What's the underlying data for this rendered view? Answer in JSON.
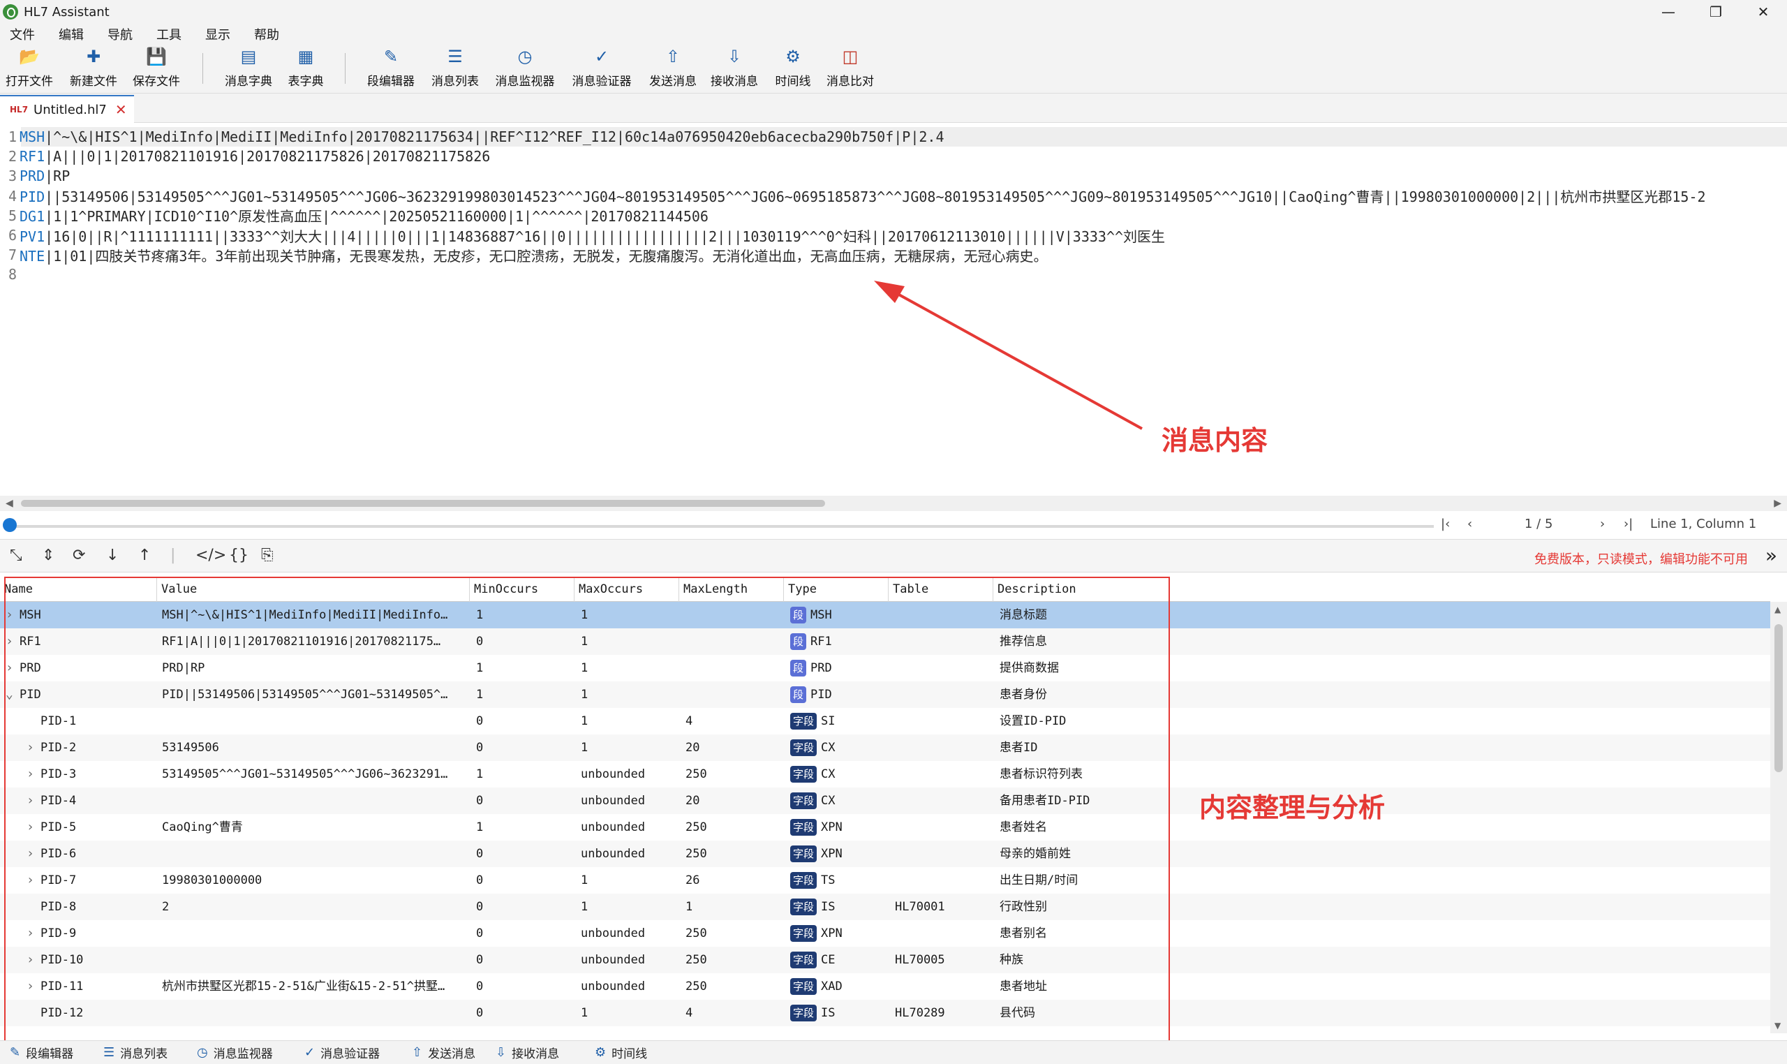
{
  "window": {
    "title": "HL7 Assistant"
  },
  "menu": [
    "文件",
    "编辑",
    "导航",
    "工具",
    "显示",
    "帮助"
  ],
  "toolbar": [
    {
      "label": "打开文件",
      "icon": "folder-open-icon"
    },
    {
      "label": "新建文件",
      "icon": "new-file-icon"
    },
    {
      "label": "保存文件",
      "icon": "save-icon"
    },
    {
      "label": "消息字典",
      "icon": "message-dictionary-icon"
    },
    {
      "label": "表字典",
      "icon": "table-dictionary-icon"
    },
    {
      "label": "段编辑器",
      "icon": "segment-editor-icon"
    },
    {
      "label": "消息列表",
      "icon": "message-list-icon"
    },
    {
      "label": "消息监视器",
      "icon": "message-monitor-icon"
    },
    {
      "label": "消息验证器",
      "icon": "message-validator-icon"
    },
    {
      "label": "发送消息",
      "icon": "send-icon"
    },
    {
      "label": "接收消息",
      "icon": "receive-icon"
    },
    {
      "label": "时间线",
      "icon": "timeline-icon"
    },
    {
      "label": "消息比对",
      "icon": "compare-icon"
    }
  ],
  "tab": {
    "badge": "HL7",
    "name": "Untitled.hl7"
  },
  "editor_lines": [
    {
      "seg": "MSH",
      "rest": "|^~\\&|HIS^1|MediInfo|MediII|MediInfo|20170821175634||REF^I12^REF_I12|60c14a076950420eb6acecba290b750f|P|2.4"
    },
    {
      "seg": "RF1",
      "rest": "|A|||0|1|20170821101916|20170821175826|20170821175826"
    },
    {
      "seg": "PRD",
      "rest": "|RP"
    },
    {
      "seg": "PID",
      "rest": "||53149506|53149505^^^JG01~53149505^^^JG06~362329199803014523^^^JG04~801953149505^^^JG06~0695185873^^^JG08~801953149505^^^JG09~801953149505^^^JG10||CaoQing^曹青||19980301000000|2|||杭州市拱墅区光郡15-2"
    },
    {
      "seg": "DG1",
      "rest": "|1|1^PRIMARY|ICD10^I10^原发性高血压|^^^^^^|20250521160000|1|^^^^^^|20170821144506"
    },
    {
      "seg": "PV1",
      "rest": "|16|0||R|^1111111111||3333^^刘大大|||4|||||0|||1|14836887^16||0|||||||||||||||||2|||1030119^^^0^妇科||20170612113010||||||V|3333^^刘医生"
    },
    {
      "seg": "NTE",
      "rest": "|1|01|四肢关节疼痛3年。3年前出现关节肿痛，无畏寒发热，无皮疹，无口腔溃疡，无脱发，无腹痛腹泻。无消化道出血，无高血压病，无糖尿病，无冠心病史。"
    },
    {
      "seg": "",
      "rest": ""
    }
  ],
  "annotations": {
    "message_content": "消息内容",
    "analysis": "内容整理与分析"
  },
  "status": {
    "page": "1 / 5",
    "cursor": "Line 1, Column 1"
  },
  "notice": "免费版本，只读模式，编辑功能不可用",
  "grid": {
    "columns": [
      "Name",
      "Value",
      "MinOccurs",
      "MaxOccurs",
      "MaxLength",
      "Type",
      "Table",
      "Description"
    ],
    "rows": [
      {
        "name": "MSH",
        "value": "MSH|^~\\&|HIS^1|MediInfo|MediII|MediInfo…",
        "min": "1",
        "max": "1",
        "len": "",
        "badge": "段",
        "type": "MSH",
        "table": "",
        "desc": "消息标题",
        "level": 0,
        "chev": ">"
      },
      {
        "name": "RF1",
        "value": "RF1|A|||0|1|20170821101916|20170821175…",
        "min": "0",
        "max": "1",
        "len": "",
        "badge": "段",
        "type": "RF1",
        "table": "",
        "desc": "推荐信息",
        "level": 0,
        "chev": ">"
      },
      {
        "name": "PRD",
        "value": "PRD|RP",
        "min": "1",
        "max": "1",
        "len": "",
        "badge": "段",
        "type": "PRD",
        "table": "",
        "desc": "提供商数据",
        "level": 0,
        "chev": ">"
      },
      {
        "name": "PID",
        "value": "PID||53149506|53149505^^^JG01~53149505^…",
        "min": "1",
        "max": "1",
        "len": "",
        "badge": "段",
        "type": "PID",
        "table": "",
        "desc": "患者身份",
        "level": 0,
        "chev": "v"
      },
      {
        "name": "PID-1",
        "value": "",
        "min": "0",
        "max": "1",
        "len": "4",
        "badge": "字段",
        "type": "SI",
        "table": "",
        "desc": "设置ID-PID",
        "level": 1,
        "chev": ""
      },
      {
        "name": "PID-2",
        "value": "53149506",
        "min": "0",
        "max": "1",
        "len": "20",
        "badge": "字段",
        "type": "CX",
        "table": "",
        "desc": "患者ID",
        "level": 1,
        "chev": ">"
      },
      {
        "name": "PID-3",
        "value": "53149505^^^JG01~53149505^^^JG06~3623291…",
        "min": "1",
        "max": "unbounded",
        "len": "250",
        "badge": "字段",
        "type": "CX",
        "table": "",
        "desc": "患者标识符列表",
        "level": 1,
        "chev": ">"
      },
      {
        "name": "PID-4",
        "value": "",
        "min": "0",
        "max": "unbounded",
        "len": "20",
        "badge": "字段",
        "type": "CX",
        "table": "",
        "desc": "备用患者ID-PID",
        "level": 1,
        "chev": ">"
      },
      {
        "name": "PID-5",
        "value": "CaoQing^曹青",
        "min": "1",
        "max": "unbounded",
        "len": "250",
        "badge": "字段",
        "type": "XPN",
        "table": "",
        "desc": "患者姓名",
        "level": 1,
        "chev": ">"
      },
      {
        "name": "PID-6",
        "value": "",
        "min": "0",
        "max": "unbounded",
        "len": "250",
        "badge": "字段",
        "type": "XPN",
        "table": "",
        "desc": "母亲的婚前姓",
        "level": 1,
        "chev": ">"
      },
      {
        "name": "PID-7",
        "value": "19980301000000",
        "min": "0",
        "max": "1",
        "len": "26",
        "badge": "字段",
        "type": "TS",
        "table": "",
        "desc": "出生日期/时间",
        "level": 1,
        "chev": ">"
      },
      {
        "name": "PID-8",
        "value": "2",
        "min": "0",
        "max": "1",
        "len": "1",
        "badge": "字段",
        "type": "IS",
        "table": "HL70001",
        "desc": "行政性别",
        "level": 1,
        "chev": ""
      },
      {
        "name": "PID-9",
        "value": "",
        "min": "0",
        "max": "unbounded",
        "len": "250",
        "badge": "字段",
        "type": "XPN",
        "table": "",
        "desc": "患者别名",
        "level": 1,
        "chev": ">"
      },
      {
        "name": "PID-10",
        "value": "",
        "min": "0",
        "max": "unbounded",
        "len": "250",
        "badge": "字段",
        "type": "CE",
        "table": "HL70005",
        "desc": "种族",
        "level": 1,
        "chev": ">"
      },
      {
        "name": "PID-11",
        "value": "杭州市拱墅区光郡15-2-51&广业街&15-2-51^拱墅…",
        "min": "0",
        "max": "unbounded",
        "len": "250",
        "badge": "字段",
        "type": "XAD",
        "table": "",
        "desc": "患者地址",
        "level": 1,
        "chev": ">"
      },
      {
        "name": "PID-12",
        "value": "",
        "min": "0",
        "max": "1",
        "len": "4",
        "badge": "字段",
        "type": "IS",
        "table": "HL70289",
        "desc": "县代码",
        "level": 1,
        "chev": ""
      }
    ]
  },
  "bottom_tabs": [
    {
      "label": "段编辑器",
      "icon": "segment-editor-icon"
    },
    {
      "label": "消息列表",
      "icon": "message-list-icon"
    },
    {
      "label": "消息监视器",
      "icon": "message-monitor-icon"
    },
    {
      "label": "消息验证器",
      "icon": "message-validator-icon"
    },
    {
      "label": "发送消息",
      "icon": "send-icon"
    },
    {
      "label": "接收消息",
      "icon": "receive-icon"
    },
    {
      "label": "时间线",
      "icon": "timeline-icon"
    }
  ],
  "colors": {
    "accent": "#1976d2",
    "annotation": "#e53935",
    "selected_row": "#aecdee",
    "segment_badge": "#5b6fd6",
    "field_badge": "#1f3b73"
  }
}
